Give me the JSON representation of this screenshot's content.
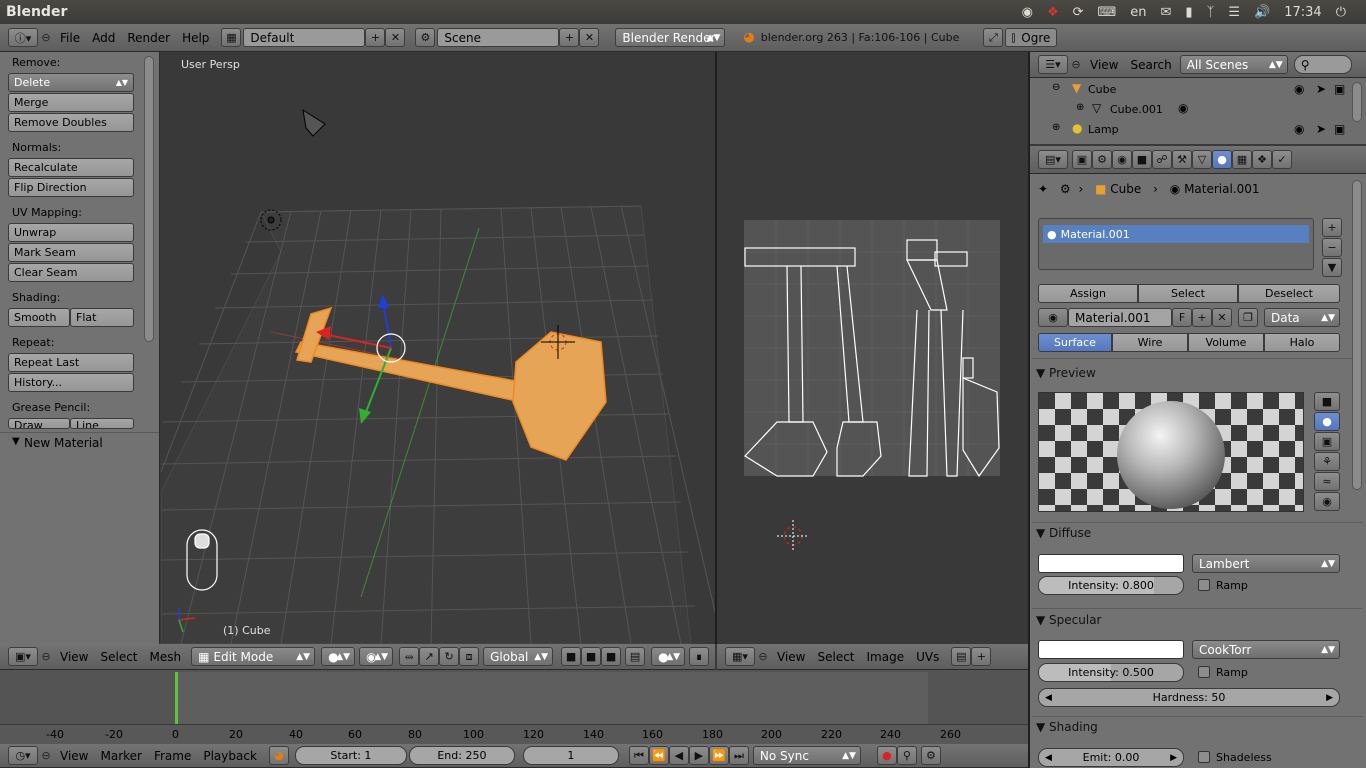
{
  "os_bar": {
    "app_title": "Blender",
    "keyboard": "en",
    "clock": "17:34"
  },
  "info_header": {
    "menus": [
      "File",
      "Add",
      "Render",
      "Help"
    ],
    "layout": "Default",
    "scene": "Scene",
    "render_engine": "Blender Render",
    "stats": "blender.org 263 | Fa:106-106 | Cube",
    "ogre_label": "Ogre"
  },
  "toolshelf": {
    "remove_label": "Remove:",
    "delete": "Delete",
    "merge": "Merge",
    "remove_doubles": "Remove Doubles",
    "normals_label": "Normals:",
    "recalculate": "Recalculate",
    "flip_direction": "Flip Direction",
    "uv_label": "UV Mapping:",
    "unwrap": "Unwrap",
    "mark_seam": "Mark Seam",
    "clear_seam": "Clear Seam",
    "shading_label": "Shading:",
    "smooth": "Smooth",
    "flat": "Flat",
    "repeat_label": "Repeat:",
    "repeat_last": "Repeat Last",
    "history": "History...",
    "grease_label": "Grease Pencil:",
    "draw": "Draw",
    "line": "Line",
    "new_material": "New Material"
  },
  "viewport": {
    "view_label": "User Persp",
    "object_label": "(1) Cube"
  },
  "view3d_header": {
    "menus": [
      "View",
      "Select",
      "Mesh"
    ],
    "mode": "Edit Mode",
    "orientation": "Global"
  },
  "uv_header": {
    "menus": [
      "View",
      "Select",
      "Image",
      "UVs"
    ]
  },
  "timeline": {
    "ticks": [
      "-40",
      "-20",
      "0",
      "20",
      "40",
      "60",
      "80",
      "100",
      "120",
      "140",
      "160",
      "180",
      "200",
      "220",
      "240",
      "260"
    ],
    "menus": [
      "View",
      "Marker",
      "Frame",
      "Playback"
    ],
    "start": "Start: 1",
    "end": "End: 250",
    "current": "1",
    "sync": "No Sync"
  },
  "outliner": {
    "menus": [
      "View",
      "Search"
    ],
    "scenes": "All Scenes",
    "items": [
      "Cube",
      "Cube.001",
      "Lamp"
    ]
  },
  "properties": {
    "crumb_object": "Cube",
    "crumb_material": "Material.001",
    "slot": "Material.001",
    "assign": "Assign",
    "select": "Select",
    "deselect": "Deselect",
    "material_name": "Material.001",
    "fake_user": "F",
    "link": "Data",
    "tabs": [
      "Surface",
      "Wire",
      "Volume",
      "Halo"
    ],
    "preview_label": "Preview",
    "diffuse_label": "Diffuse",
    "diffuse_shader": "Lambert",
    "diffuse_intensity": "Intensity: 0.800",
    "diffuse_intensity_value": 0.8,
    "ramp": "Ramp",
    "specular_label": "Specular",
    "specular_shader": "CookTorr",
    "specular_intensity": "Intensity: 0.500",
    "specular_intensity_value": 0.5,
    "hardness": "Hardness: 50",
    "shading_label": "Shading",
    "emit": "Emit: 0.00",
    "shadeless": "Shadeless"
  }
}
